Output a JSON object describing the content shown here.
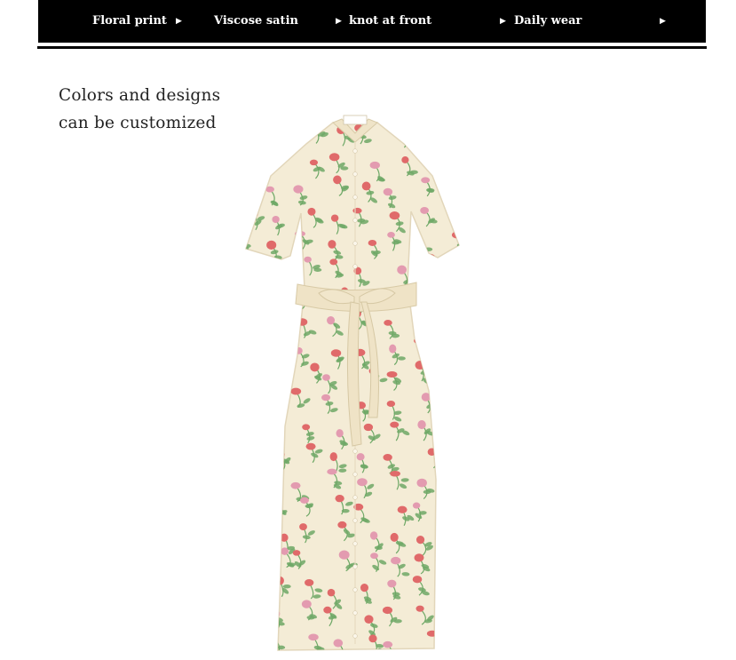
{
  "features": [
    {
      "label": "Floral print"
    },
    {
      "label": "Viscose satin"
    },
    {
      "label": "knot at front"
    },
    {
      "label": "Daily wear"
    }
  ],
  "caption": {
    "line1": "Colors and designs",
    "line2": "can be customized"
  },
  "colors": {
    "bar": "#000000",
    "fabric": "#f4ecd6",
    "flower": "#e06a6a",
    "bud": "#e39bb0",
    "leaf": "#6ea866"
  },
  "icons": [
    "play-arrow-icon"
  ]
}
